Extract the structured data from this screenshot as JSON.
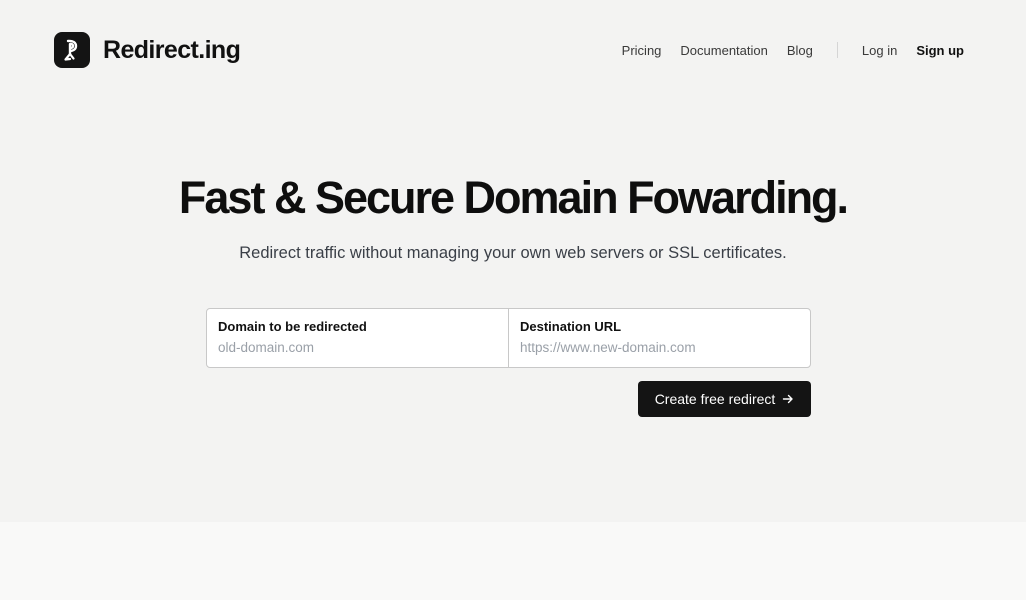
{
  "brand": {
    "name": "Redirect.ing",
    "logo_icon": "arrow-curl-down-icon"
  },
  "nav": {
    "links": [
      "Pricing",
      "Documentation",
      "Blog"
    ],
    "login": "Log in",
    "signup": "Sign up"
  },
  "hero": {
    "title": "Fast & Secure Domain Fowarding.",
    "subtitle": "Redirect traffic without managing your own web servers or SSL certificates."
  },
  "form": {
    "source": {
      "label": "Domain to be redirected",
      "placeholder": "old-domain.com",
      "value": ""
    },
    "destination": {
      "label": "Destination URL",
      "placeholder": "https://www.new-domain.com",
      "value": ""
    },
    "submit_label": "Create free redirect",
    "submit_icon": "arrow-right-icon"
  },
  "colors": {
    "background": "#f3f3f2",
    "primary_button": "#141414",
    "text": "#111111",
    "muted_text": "#3a3f47",
    "placeholder": "#9aa0a8"
  }
}
